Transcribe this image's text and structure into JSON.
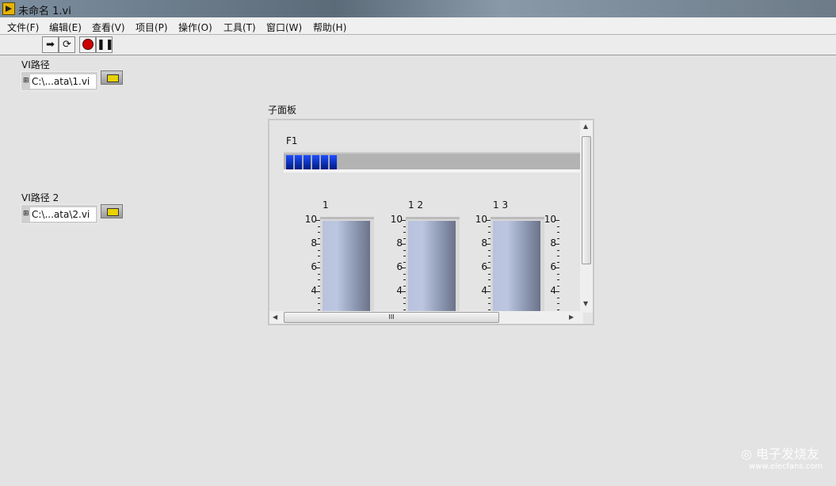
{
  "window": {
    "title": "未命名 1.vi"
  },
  "menu": [
    "文件(F)",
    "编辑(E)",
    "查看(V)",
    "项目(P)",
    "操作(O)",
    "工具(T)",
    "窗口(W)",
    "帮助(H)"
  ],
  "toolbar": {
    "run": "run-icon",
    "run_continuously": "run-continuously-icon",
    "abort": "abort-icon",
    "pause": "pause-icon"
  },
  "controls": [
    {
      "label": "VI路径",
      "value": "C:\\...ata\\1.vi"
    },
    {
      "label": "VI路径 2",
      "value": "C:\\...ata\\2.vi"
    }
  ],
  "subpanel": {
    "label": "子面板",
    "progress": {
      "label": "F1",
      "blocks_filled": 6
    },
    "tanks": [
      {
        "label": "1",
        "ticks": [
          "10",
          "8",
          "6",
          "4"
        ]
      },
      {
        "label": "1 2",
        "ticks": [
          "10",
          "8",
          "6",
          "4"
        ]
      },
      {
        "label": "1 3",
        "ticks": [
          "10",
          "8",
          "6",
          "4"
        ]
      },
      {
        "label": "",
        "ticks": [
          "10",
          "8",
          "6",
          "4"
        ]
      }
    ]
  },
  "watermark": {
    "name": "电子发烧友",
    "url": "www.elecfans.com"
  }
}
